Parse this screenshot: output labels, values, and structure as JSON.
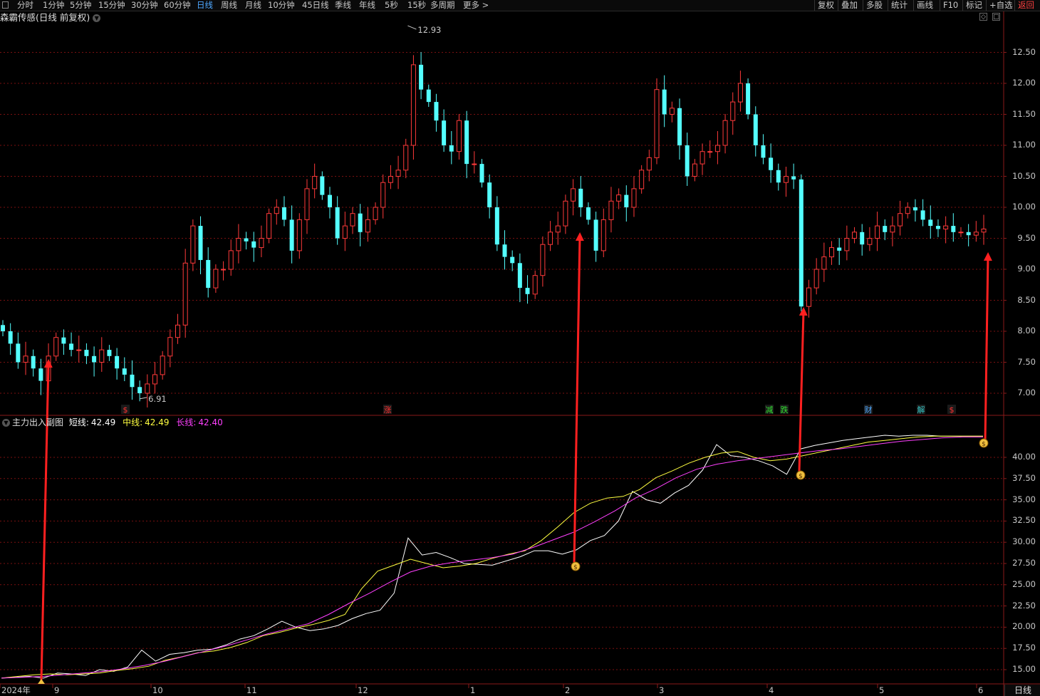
{
  "toolbar": {
    "periods": [
      "分时",
      "1分钟",
      "5分钟",
      "15分钟",
      "30分钟",
      "60分钟",
      "日线",
      "周线",
      "月线",
      "10分钟",
      "45日线",
      "季线",
      "年线",
      "5秒",
      "15秒",
      "多周期",
      "更多 >"
    ],
    "active_period": "日线",
    "right_buttons": [
      "复权",
      "叠加",
      "多股",
      "统计",
      "画线",
      "F10",
      "标记",
      "+自选",
      "返回"
    ]
  },
  "chart_title": "森霸传感(日线 前复权)",
  "price_axis": [
    "12.50",
    "12.00",
    "11.50",
    "11.00",
    "10.50",
    "10.00",
    "9.50",
    "9.00",
    "8.50",
    "8.00",
    "7.50",
    "7.00"
  ],
  "price_extremes": {
    "high": "12.93",
    "low": "6.91"
  },
  "event_markers": [
    {
      "text": "$",
      "color": "#ff3030"
    },
    {
      "text": "涨",
      "color": "#ff3030"
    },
    {
      "text": "减",
      "color": "#30e030"
    },
    {
      "text": "跌",
      "color": "#30e030"
    },
    {
      "text": "财",
      "color": "#4ea8ff"
    },
    {
      "text": "解",
      "color": "#30c0c0"
    },
    {
      "text": "$",
      "color": "#ff3030"
    }
  ],
  "indicator": {
    "name": "主力出入副图",
    "short_label": "短线:",
    "short_value": "42.49",
    "mid_label": "中线:",
    "mid_value": "42.49",
    "long_label": "长线:",
    "long_value": "42.40",
    "axis": [
      "40.00",
      "37.50",
      "35.00",
      "32.50",
      "30.00",
      "27.50",
      "25.00",
      "22.50",
      "20.00",
      "17.50",
      "15.00"
    ]
  },
  "time_axis": [
    "2024年",
    "9",
    "10",
    "11",
    "12",
    "1",
    "2",
    "3",
    "4",
    "5",
    "6"
  ],
  "bottom_tag": "日线",
  "colors": {
    "up": "#ff3a3a",
    "down": "#54ffff",
    "short": "#ffffff",
    "mid": "#ffff40",
    "long": "#ff40ff",
    "arrow": "#ff2020",
    "grid": "#7a1010"
  },
  "chart_data": [
    {
      "type": "candlestick",
      "title": "森霸传感(日线 前复权)",
      "ylim": [
        6.7,
        13.1
      ],
      "x_ticks": [
        "2024年",
        "9",
        "10",
        "11",
        "12",
        "1",
        "2",
        "3",
        "4",
        "5",
        "6"
      ],
      "ohlc_close_estimates": [
        8.0,
        7.8,
        7.5,
        7.6,
        7.4,
        7.2,
        7.6,
        7.9,
        7.8,
        7.7,
        7.7,
        7.6,
        7.5,
        7.7,
        7.6,
        7.4,
        7.3,
        7.1,
        7.0,
        7.15,
        7.3,
        7.6,
        7.9,
        8.1,
        9.1,
        9.7,
        9.15,
        8.7,
        9.0,
        9.0,
        9.3,
        9.5,
        9.45,
        9.35,
        9.5,
        9.9,
        10.0,
        9.8,
        9.3,
        9.8,
        10.3,
        10.5,
        10.2,
        10.0,
        9.5,
        9.7,
        9.9,
        9.6,
        9.8,
        10.0,
        10.4,
        10.5,
        10.6,
        11.0,
        12.3,
        11.9,
        11.7,
        11.4,
        11.0,
        10.9,
        11.4,
        10.7,
        10.7,
        10.4,
        10.0,
        9.4,
        9.2,
        9.1,
        8.7,
        8.6,
        8.9,
        9.4,
        9.6,
        9.7,
        10.1,
        10.3,
        10.0,
        9.8,
        9.3,
        9.8,
        10.1,
        10.2,
        10.0,
        10.3,
        10.6,
        10.8,
        11.9,
        11.5,
        11.6,
        11.0,
        10.5,
        10.7,
        10.9,
        10.9,
        11.0,
        11.4,
        11.7,
        12.0,
        11.5,
        11.0,
        10.8,
        10.6,
        10.4,
        10.5,
        10.45,
        8.4,
        8.7,
        9.0,
        9.2,
        9.35,
        9.3,
        9.5,
        9.6,
        9.4,
        9.5,
        9.7,
        9.6,
        9.7,
        9.9,
        10.0,
        9.95,
        9.8,
        9.7,
        9.65,
        9.7,
        9.6,
        9.6,
        9.55,
        9.6,
        9.65
      ]
    },
    {
      "type": "line",
      "title": "主力出入副图",
      "ylim": [
        14.0,
        43.0
      ],
      "series": [
        {
          "name": "短线",
          "final": 42.49,
          "values": [
            14.0,
            14.1,
            14.2,
            14.0,
            14.6,
            14.5,
            14.3,
            15.0,
            14.8,
            15.3,
            17.3,
            16.0,
            16.8,
            17.0,
            17.3,
            17.4,
            17.9,
            18.6,
            19.0,
            19.8,
            20.7,
            20.0,
            19.6,
            19.8,
            20.2,
            21.0,
            21.6,
            22.0,
            24.0,
            30.5,
            28.5,
            28.8,
            28.2,
            27.5,
            27.4,
            27.3,
            27.8,
            28.3,
            29.0,
            29.0,
            28.6,
            29.1,
            30.2,
            30.8,
            32.5,
            36.0,
            35.0,
            34.6,
            35.8,
            36.7,
            38.5,
            41.5,
            40.2,
            40.0,
            39.6,
            39.0,
            38.0,
            41.0,
            41.4,
            41.7,
            42.0,
            42.2,
            42.4,
            42.6,
            42.5,
            42.6,
            42.6,
            42.5,
            42.5,
            42.5,
            42.49
          ]
        },
        {
          "name": "中线",
          "final": 42.49,
          "values": [
            14.0,
            14.2,
            14.4,
            14.5,
            14.4,
            14.5,
            14.6,
            14.9,
            15.1,
            15.4,
            16.1,
            16.5,
            17.0,
            17.2,
            17.6,
            18.2,
            19.0,
            19.4,
            19.9,
            20.3,
            20.8,
            21.5,
            24.5,
            26.6,
            27.3,
            28.0,
            27.5,
            27.0,
            27.2,
            27.5,
            28.1,
            28.6,
            29.0,
            30.2,
            31.8,
            33.5,
            34.6,
            35.2,
            35.4,
            36.2,
            37.6,
            38.4,
            39.3,
            40.0,
            40.5,
            40.7,
            40.0,
            39.6,
            39.8,
            40.2,
            40.6,
            41.0,
            41.4,
            41.8,
            42.0,
            42.2,
            42.4,
            42.5,
            42.5,
            42.5,
            42.49
          ]
        },
        {
          "name": "长线",
          "final": 42.4,
          "values": [
            14.0,
            14.1,
            14.2,
            14.4,
            14.6,
            14.8,
            15.1,
            15.5,
            16.0,
            16.6,
            17.2,
            17.8,
            18.5,
            19.2,
            19.8,
            20.4,
            21.5,
            22.8,
            24.0,
            25.3,
            26.5,
            27.2,
            27.6,
            27.9,
            28.2,
            28.6,
            29.4,
            30.3,
            31.2,
            32.4,
            33.7,
            35.2,
            36.3,
            37.6,
            38.6,
            39.2,
            39.6,
            39.9,
            40.2,
            40.5,
            40.8,
            41.0,
            41.3,
            41.6,
            41.9,
            42.1,
            42.3,
            42.4,
            42.4
          ]
        }
      ]
    }
  ]
}
